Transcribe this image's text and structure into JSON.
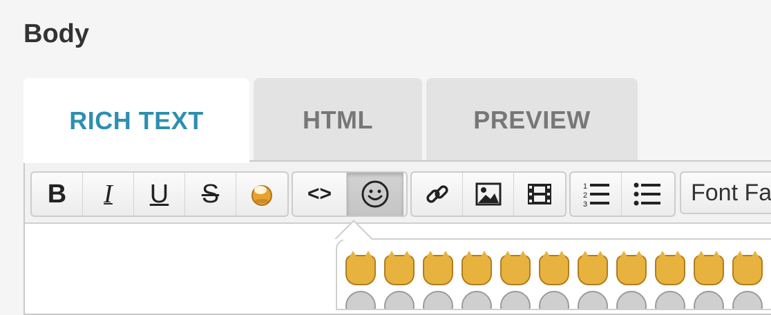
{
  "section": {
    "label": "Body"
  },
  "tabs": [
    {
      "label": "RICH TEXT",
      "active": true
    },
    {
      "label": "HTML",
      "active": false
    },
    {
      "label": "PREVIEW",
      "active": false
    }
  ],
  "toolbar": {
    "bold_label": "B",
    "italic_label": "I",
    "underline_label": "U",
    "strike_label": "S",
    "code_label": "<>",
    "font_family_label": "Font Family"
  },
  "icons": {
    "bold": "bold-icon",
    "italic": "italic-icon",
    "underline": "underline-icon",
    "strikethrough": "strikethrough-icon",
    "text_color": "paint-bucket-icon",
    "code": "code-icon",
    "emoji": "smiley-icon",
    "link": "link-icon",
    "image": "image-icon",
    "video": "film-icon",
    "ordered_list": "ordered-list-icon",
    "unordered_list": "unordered-list-icon"
  },
  "colors": {
    "active_tab_text": "#2e8fb0",
    "inactive_tab_text": "#777777",
    "emoji_cat": "#e7b23e",
    "emoji_face": "#cfcfcf"
  },
  "emoji_popup": {
    "row1": [
      "cat",
      "cat",
      "cat",
      "cat",
      "cat",
      "cat",
      "cat",
      "cat",
      "cat",
      "cat",
      "cat"
    ],
    "row2": [
      "face",
      "face",
      "face",
      "face",
      "face",
      "face",
      "face",
      "face",
      "face",
      "face",
      "face"
    ]
  }
}
